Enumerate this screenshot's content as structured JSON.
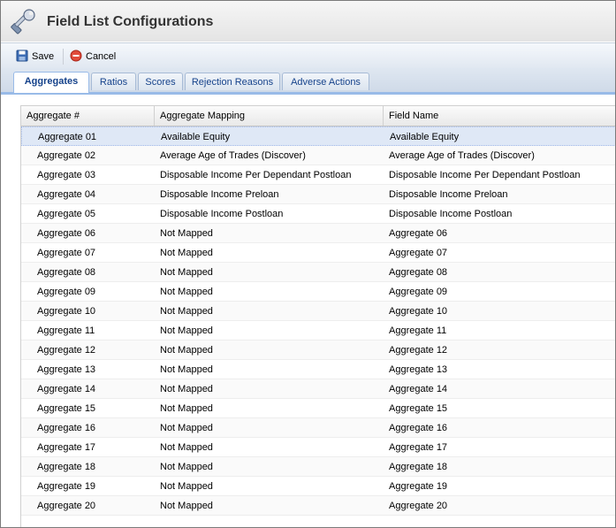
{
  "title": "Field List Configurations",
  "toolbar": {
    "save_label": "Save",
    "cancel_label": "Cancel"
  },
  "tabs": [
    {
      "label": "Aggregates",
      "active": true
    },
    {
      "label": "Ratios"
    },
    {
      "label": "Scores"
    },
    {
      "label": "Rejection Reasons"
    },
    {
      "label": "Adverse Actions"
    }
  ],
  "grid": {
    "columns": [
      "Aggregate #",
      "Aggregate Mapping",
      "Field Name"
    ],
    "rows": [
      [
        "Aggregate 01",
        "Available Equity",
        "Available Equity"
      ],
      [
        "Aggregate 02",
        "Average Age of Trades (Discover)",
        "Average Age of Trades (Discover)"
      ],
      [
        "Aggregate 03",
        "Disposable Income Per Dependant Postloan",
        "Disposable Income Per Dependant Postloan"
      ],
      [
        "Aggregate 04",
        "Disposable Income Preloan",
        "Disposable Income Preloan"
      ],
      [
        "Aggregate 05",
        "Disposable Income Postloan",
        "Disposable Income Postloan"
      ],
      [
        "Aggregate 06",
        "Not Mapped",
        "Aggregate 06"
      ],
      [
        "Aggregate 07",
        "Not Mapped",
        "Aggregate 07"
      ],
      [
        "Aggregate 08",
        "Not Mapped",
        "Aggregate 08"
      ],
      [
        "Aggregate 09",
        "Not Mapped",
        "Aggregate 09"
      ],
      [
        "Aggregate 10",
        "Not Mapped",
        "Aggregate 10"
      ],
      [
        "Aggregate 11",
        "Not Mapped",
        "Aggregate 11"
      ],
      [
        "Aggregate 12",
        "Not Mapped",
        "Aggregate 12"
      ],
      [
        "Aggregate 13",
        "Not Mapped",
        "Aggregate 13"
      ],
      [
        "Aggregate 14",
        "Not Mapped",
        "Aggregate 14"
      ],
      [
        "Aggregate 15",
        "Not Mapped",
        "Aggregate 15"
      ],
      [
        "Aggregate 16",
        "Not Mapped",
        "Aggregate 16"
      ],
      [
        "Aggregate 17",
        "Not Mapped",
        "Aggregate 17"
      ],
      [
        "Aggregate 18",
        "Not Mapped",
        "Aggregate 18"
      ],
      [
        "Aggregate 19",
        "Not Mapped",
        "Aggregate 19"
      ],
      [
        "Aggregate 20",
        "Not Mapped",
        "Aggregate 20"
      ]
    ],
    "selected_row": 0
  },
  "icons": {
    "title": "wrench-screwdriver-icon",
    "save": "floppy-disk-icon",
    "cancel": "cancel-icon"
  },
  "colors": {
    "tab_text": "#15428b",
    "selected_row": "#dfe8f6",
    "tab_border": "#99bbe8"
  }
}
